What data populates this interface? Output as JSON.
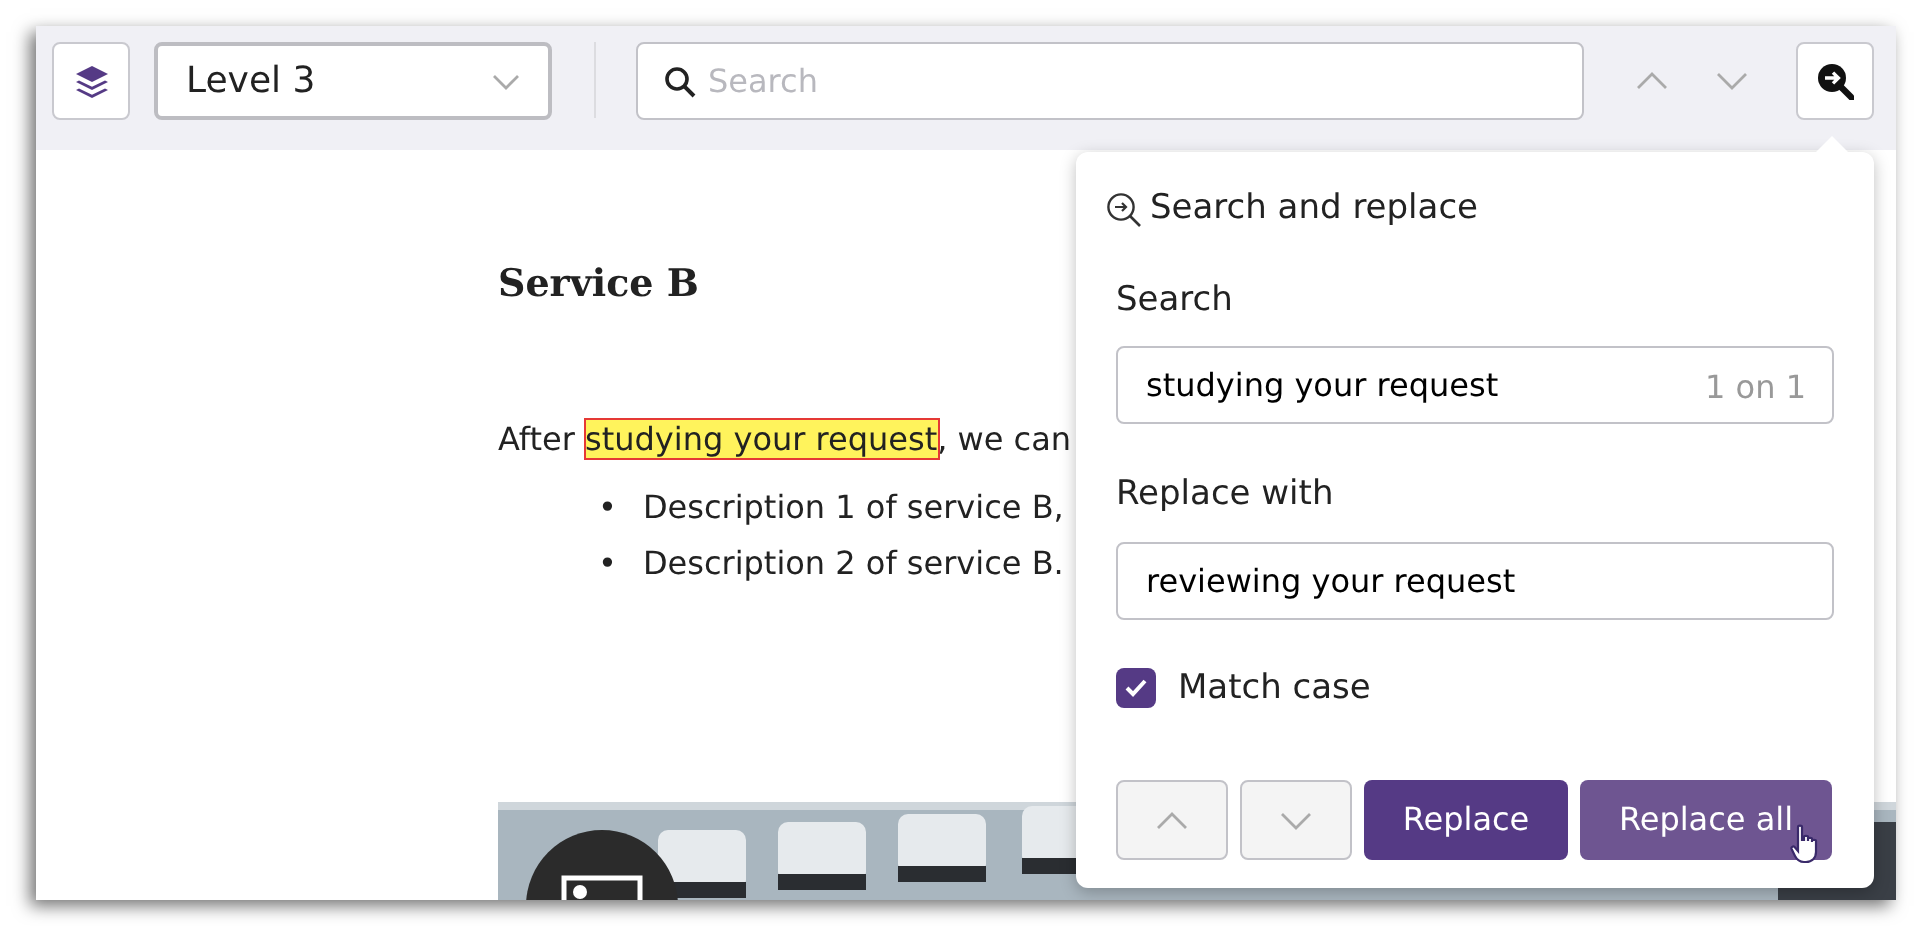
{
  "toolbar": {
    "level_select": {
      "value": "Level 3"
    },
    "search": {
      "placeholder": "Search"
    }
  },
  "document": {
    "heading": "Service B",
    "paragraph": {
      "before": "After ",
      "match": "studying your request",
      "after": ", we can"
    },
    "bullets": [
      {
        "marker": "•",
        "text": "Description 1 of service B,"
      },
      {
        "marker": "•",
        "text": "Description 2 of service B."
      }
    ]
  },
  "replace_panel": {
    "title": "Search and replace",
    "search_label": "Search",
    "search_value": "studying your request",
    "match_count": "1 on 1",
    "replace_label": "Replace with",
    "replace_value": "reviewing your request",
    "match_case": {
      "label": "Match case",
      "checked": true
    },
    "buttons": [
      {
        "label": "Replace",
        "hovered": false
      },
      {
        "label": "Replace all",
        "hovered": true
      }
    ]
  }
}
